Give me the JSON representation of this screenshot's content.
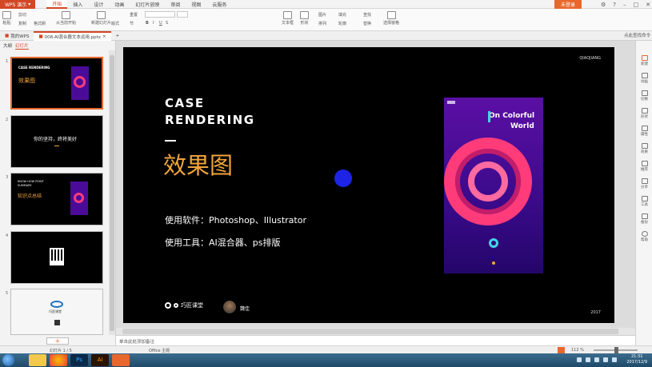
{
  "titlebar": {
    "app_name": "WPS 演示",
    "menu_tabs": [
      "开始",
      "插入",
      "设计",
      "动画",
      "幻灯片放映",
      "审阅",
      "视图",
      "云服务"
    ],
    "login_label": "未登录"
  },
  "ribbon": {
    "paste": "粘贴",
    "cut": "剪切",
    "copy": "复制",
    "format_painter": "格式刷",
    "from_start": "从当前开始",
    "new_slide": "新建幻灯片",
    "layout": "版式",
    "section": "节",
    "reset": "重置",
    "bold": "B",
    "italic": "I",
    "underline": "U",
    "strike": "S",
    "text_box": "文本框",
    "shape": "形状",
    "arrange": "排列",
    "outline": "轮廓",
    "picture": "图片",
    "fill": "填充",
    "find": "查找",
    "replace": "替换",
    "select_pane": "选择窗格"
  },
  "doc_tabs": {
    "home": "我的WPS",
    "file": "008-AI混合器文本运用.pptx"
  },
  "search_placeholder": "点此查找命令",
  "left_panel": {
    "tabs": [
      "大纲",
      "幻灯片"
    ],
    "slides": [
      {
        "num": "1",
        "title_en": "CASE RENDERING",
        "title_cn": "效果图"
      },
      {
        "num": "2",
        "text": "你的坚持，终将美好"
      },
      {
        "num": "3",
        "title_en": "KNOW HOW POINT SUMMARY",
        "title_cn": "知识点总结"
      },
      {
        "num": "4"
      },
      {
        "num": "5",
        "label": "巧匠课堂"
      }
    ]
  },
  "slide": {
    "corner_top": "QIAOJIANG",
    "title_line1": "CASE",
    "title_line2": "RENDERING",
    "title_cn": "效果图",
    "software_line": "使用软件：Photoshop、Illustrator",
    "tools_line": "使用工具：AI混合器、ps排版",
    "poster_title_1": "On Colorful",
    "poster_title_2": "World",
    "brand": "巧匠课堂",
    "author": "魏佳",
    "year": "2017"
  },
  "notes_placeholder": "单击此处添加备注",
  "right_sidebar": [
    "新建",
    "动画",
    "切换",
    "形状",
    "属性",
    "效果",
    "推荐",
    "分享",
    "工具",
    "备份",
    "帮助"
  ],
  "status": {
    "slide_info": "幻灯片 1 / 5",
    "theme": "Office 主题",
    "zoom": "112 %"
  },
  "taskbar": {
    "time": "21:31",
    "date": "2017/12/9"
  },
  "colors": {
    "accent": "#d24726",
    "title_cn": "#f0a53a",
    "poster_bg": "#3a0a8a",
    "poster_ring": "#ff3b7a",
    "poster_text": "#ffffff"
  }
}
